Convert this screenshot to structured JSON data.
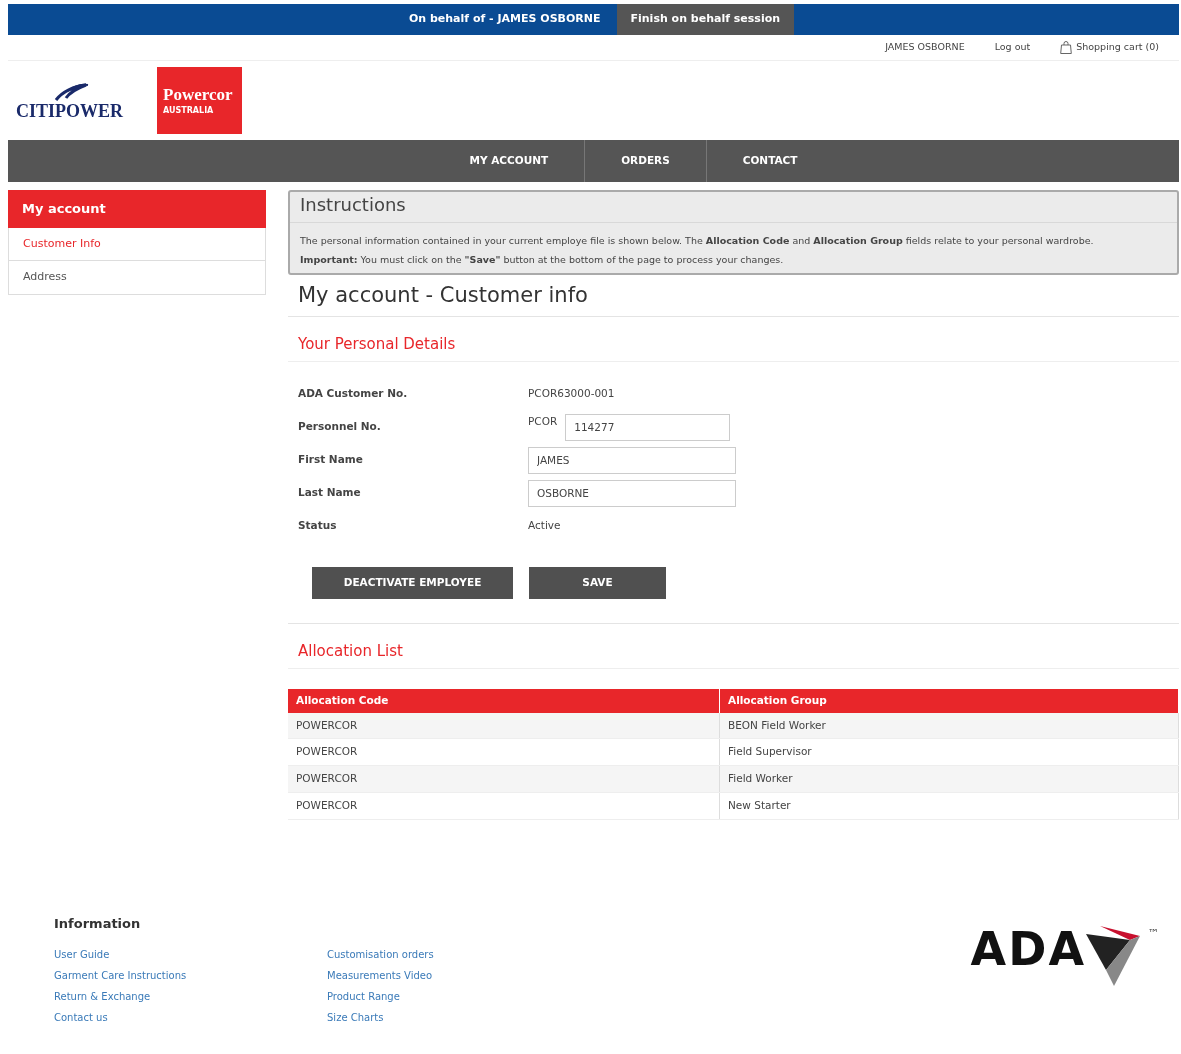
{
  "behalf_bar": {
    "label": "On behalf of - JAMES OSBORNE",
    "finish_button": "Finish on behalf session"
  },
  "user_links": {
    "user": "JAMES OSBORNE",
    "logout": "Log out",
    "cart": "Shopping cart (0)"
  },
  "logos": {
    "citipower": "CITIPOWER",
    "powercor": "Powercor",
    "powercor_sub": "AUSTRALIA"
  },
  "nav": [
    {
      "label": "MY ACCOUNT",
      "selected": false
    },
    {
      "label": "ORDERS",
      "selected": false
    },
    {
      "label": "CONTACT",
      "selected": false
    }
  ],
  "sidebar": {
    "title": "My account",
    "items": [
      {
        "label": "Customer Info",
        "selected": true
      },
      {
        "label": "Address",
        "selected": false
      }
    ]
  },
  "instructions": {
    "title": "Instructions",
    "lines": [
      "The personal information contained in your current employe file is shown below. The **Allocation Code** and **Allocation Group** fields relate to your personal wardrobe.",
      "**Important:** You must click on the **\"Save\"** button at the bottom of the page to process your changes."
    ]
  },
  "page_title": "My account - Customer info",
  "personal_details": {
    "heading": "Your Personal Details",
    "fields": [
      {
        "kind": "text",
        "label": "ADA Customer No.",
        "value": "PCOR63000-001"
      },
      {
        "kind": "prefixed",
        "label": "Personnel No.",
        "prefix": "PCOR",
        "value": "114277"
      },
      {
        "kind": "input",
        "label": "First Name",
        "value": "JAMES"
      },
      {
        "kind": "input",
        "label": "Last Name",
        "value": "OSBORNE"
      },
      {
        "kind": "text",
        "label": "Status",
        "value": "Active"
      }
    ]
  },
  "buttons": [
    "DEACTIVATE EMPLOYEE",
    "SAVE"
  ],
  "allocation_list": {
    "heading": "Allocation List",
    "columns": [
      "Allocation Code",
      "Allocation Group"
    ],
    "rows": [
      [
        "POWERCOR",
        "BEON Field Worker"
      ],
      [
        "POWERCOR",
        "Field Supervisor"
      ],
      [
        "POWERCOR",
        "Field Worker"
      ],
      [
        "POWERCOR",
        "New Starter"
      ]
    ]
  },
  "footer": {
    "heading": "Information",
    "links": [
      [
        "User Guide",
        "Garment Care Instructions",
        "Return & Exchange",
        "Contact us"
      ],
      [
        "Customisation orders",
        "Measurements Video",
        "Product Range",
        "Size Charts"
      ]
    ],
    "logo": "ADA",
    "trademark": "™"
  }
}
